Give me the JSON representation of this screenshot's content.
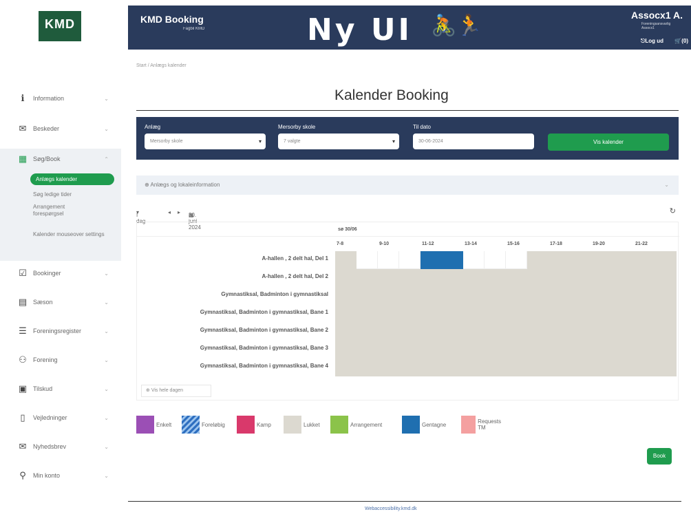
{
  "sidebar": {
    "logo": "KMD",
    "items": [
      {
        "label": "Information",
        "icon": "info-icon"
      },
      {
        "label": "Beskeder",
        "icon": "messages-icon"
      },
      {
        "label": "Søg/Book",
        "icon": "calendar-icon"
      },
      {
        "label": "Bookinger",
        "icon": "checkbox-calendar-icon"
      },
      {
        "label": "Sæson",
        "icon": "season-icon"
      },
      {
        "label": "Foreningsregister",
        "icon": "list-icon"
      },
      {
        "label": "Forening",
        "icon": "group-icon"
      },
      {
        "label": "Tilskud",
        "icon": "subsidy-icon"
      },
      {
        "label": "Vejledninger",
        "icon": "document-icon"
      },
      {
        "label": "Nyhedsbrev",
        "icon": "newsletter-icon"
      },
      {
        "label": "Min konto",
        "icon": "account-icon"
      }
    ],
    "sub_items": {
      "active": "Anlægs kalender",
      "ledige": "Søg ledige tider",
      "arrangement": "Arrangement forespørgsel",
      "mouseover": "Kalender mouseover settings"
    }
  },
  "header": {
    "app_title": "KMD Booking",
    "app_subtitle": "Fagbil KMD",
    "banner": "Ny UI",
    "user_name": "Assocx1 A.",
    "user_role": "Foreningsansvarlig Assocx1",
    "logout": "Log ud",
    "cart": "(0)"
  },
  "breadcrumb": "Start / Anlægs kalender",
  "page_title": "Kalender Booking",
  "filters": {
    "anlaeg_label": "Anlæg",
    "anlaeg_value": "Mersorby skole",
    "mersorby_label": "Mersorby skole",
    "mersorby_value": "7 valgte",
    "date_label": "Til dato",
    "date_value": "30-06-2024",
    "show_button": "Vis kalender"
  },
  "info_bar": "Anlægs og lokaleinformation",
  "toolbar": {
    "view": "I dag",
    "date": "30. juni 2024"
  },
  "calendar": {
    "week": "sø 30/06",
    "time_slots": [
      "7-8",
      "9-10",
      "11-12",
      "13-14",
      "15-16",
      "17-18",
      "19-20",
      "21-22"
    ],
    "rows": [
      "A-hallen , 2 delt hal, Del 1",
      "A-hallen , 2 delt hal, Del 2",
      "Gymnastiksal, Badminton i gymnastiksal",
      "Gymnastiksal, Badminton i gymnastiksal, Bane 1",
      "Gymnastiksal, Badminton i gymnastiksal, Bane 2",
      "Gymnastiksal, Badminton i gymnastiksal, Bane 3",
      "Gymnastiksal, Badminton i gymnastiksal, Bane 4"
    ],
    "show_whole_day": "Vis hele dagen"
  },
  "legend": [
    {
      "label": "Enkelt",
      "color": "#9b4fb5"
    },
    {
      "label": "Foreløbig",
      "color": "#2e6fc0"
    },
    {
      "label": "Kamp",
      "color": "#d9396b"
    },
    {
      "label": "Lukket",
      "color": "#dcd9d0"
    },
    {
      "label": "Arrangement",
      "color": "#8bc34a"
    },
    {
      "label": "Gentagne",
      "color": "#1f6fb0"
    },
    {
      "label": "Requests TM",
      "color": "#f4a0a0"
    }
  ],
  "book_button": "Book",
  "footer_link": "Webaccessibility.kmd.dk"
}
